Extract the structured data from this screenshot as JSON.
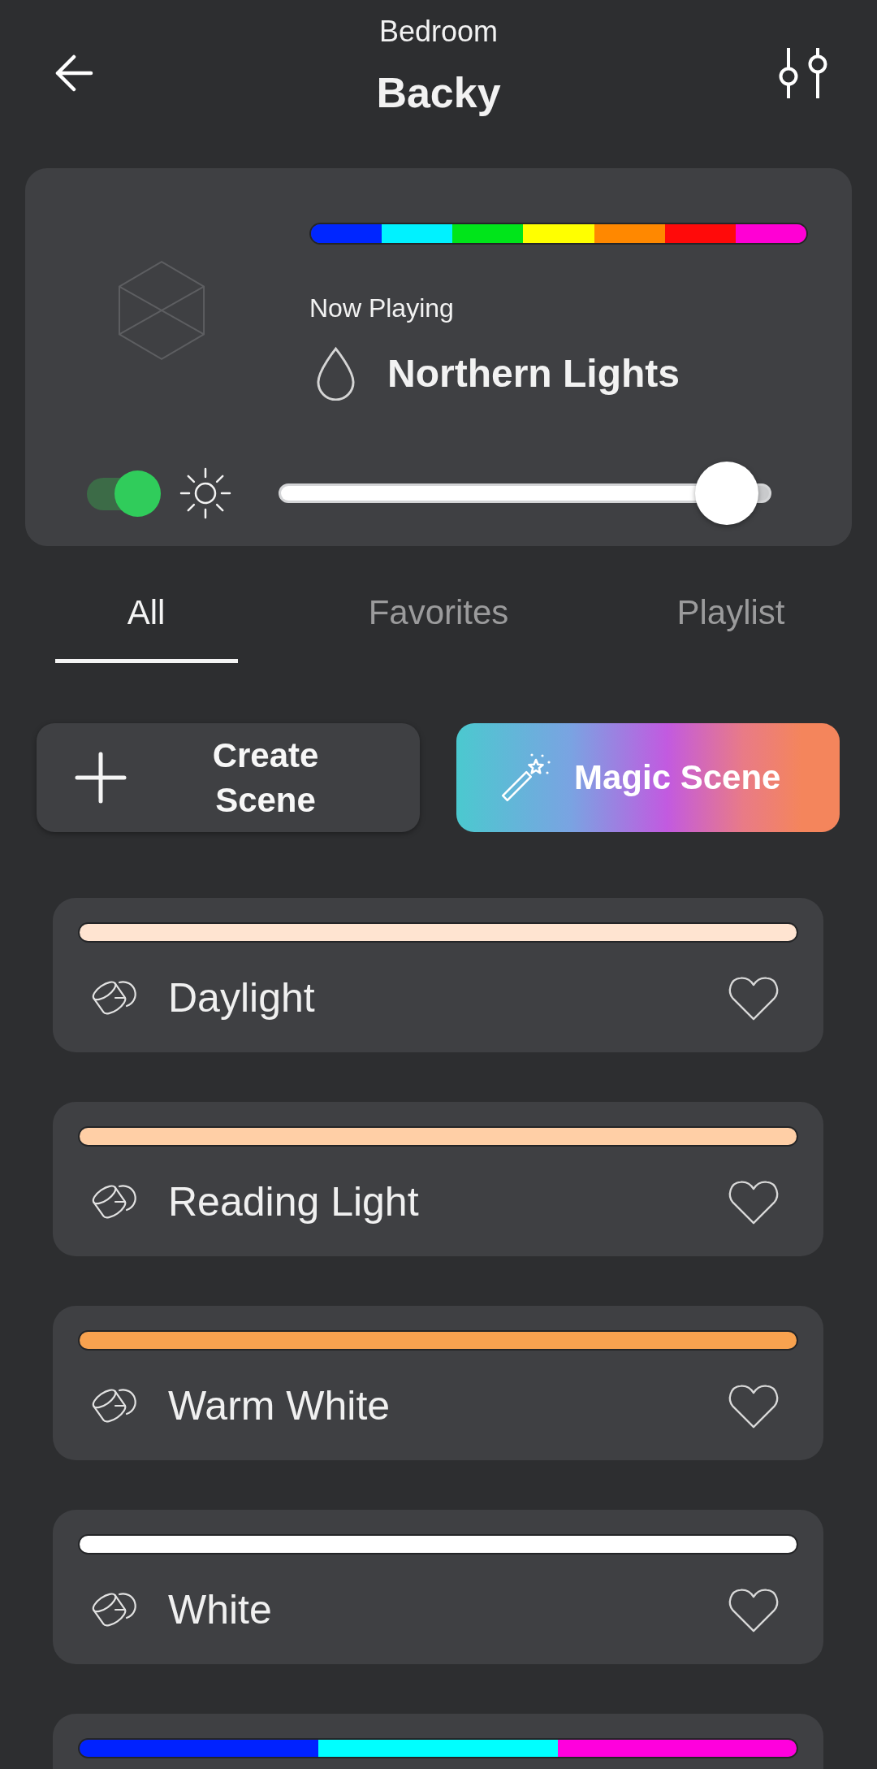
{
  "header": {
    "subtitle": "Bedroom",
    "title": "Backy"
  },
  "now_playing": {
    "palette": [
      {
        "color": "#0026ff"
      },
      {
        "color": "#00f2ff"
      },
      {
        "color": "#00e51a"
      },
      {
        "color": "#ffff00"
      },
      {
        "color": "#ff8800"
      },
      {
        "color": "#ff0a0a"
      },
      {
        "color": "#ff00d4"
      }
    ],
    "label": "Now Playing",
    "scene": "Northern Lights",
    "power": {
      "on": true
    },
    "brightness": {
      "level": 0.91
    }
  },
  "tabs": [
    {
      "label": "All",
      "selected": true
    },
    {
      "label": "Favorites",
      "selected": false
    },
    {
      "label": "Playlist",
      "selected": false
    }
  ],
  "actions": [
    {
      "kind": "create",
      "label": "Create Scene"
    },
    {
      "kind": "magic",
      "label": "Magic Scene"
    }
  ],
  "scenes": [
    {
      "name": "Daylight",
      "favorite": false,
      "palette": [
        {
          "color": "#ffe4d1"
        }
      ]
    },
    {
      "name": "Reading Light",
      "favorite": false,
      "palette": [
        {
          "color": "#ffcfa6"
        }
      ]
    },
    {
      "name": "Warm White",
      "favorite": false,
      "palette": [
        {
          "color": "#f8a24f"
        }
      ]
    },
    {
      "name": "White",
      "favorite": false,
      "palette": [
        {
          "color": "#ffffff"
        }
      ]
    },
    {
      "palette": [
        {
          "color": "#0022ff"
        },
        {
          "color": "#00ffff"
        },
        {
          "color": "#ff00dd"
        }
      ]
    }
  ]
}
